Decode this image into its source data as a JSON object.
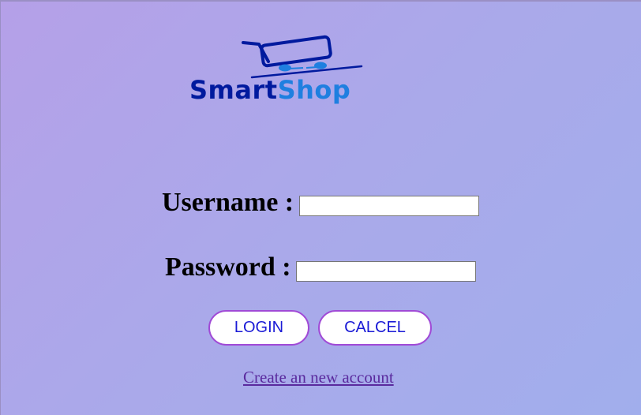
{
  "logo": {
    "brand_part1": "Smart",
    "brand_part2": "Shop",
    "icon": "shopping-cart-icon",
    "colors": {
      "dark": "#001a9e",
      "light": "#1f7fe0"
    }
  },
  "form": {
    "username_label": "Username :",
    "username_value": "",
    "password_label": "Password :",
    "password_value": ""
  },
  "buttons": {
    "login_label": "LOGIN",
    "cancel_label": "CALCEL"
  },
  "links": {
    "create_account": "Create an new account"
  },
  "colors": {
    "button_border": "#a04ad6",
    "button_text": "#1a1ad6",
    "link": "#5a2a9e"
  }
}
